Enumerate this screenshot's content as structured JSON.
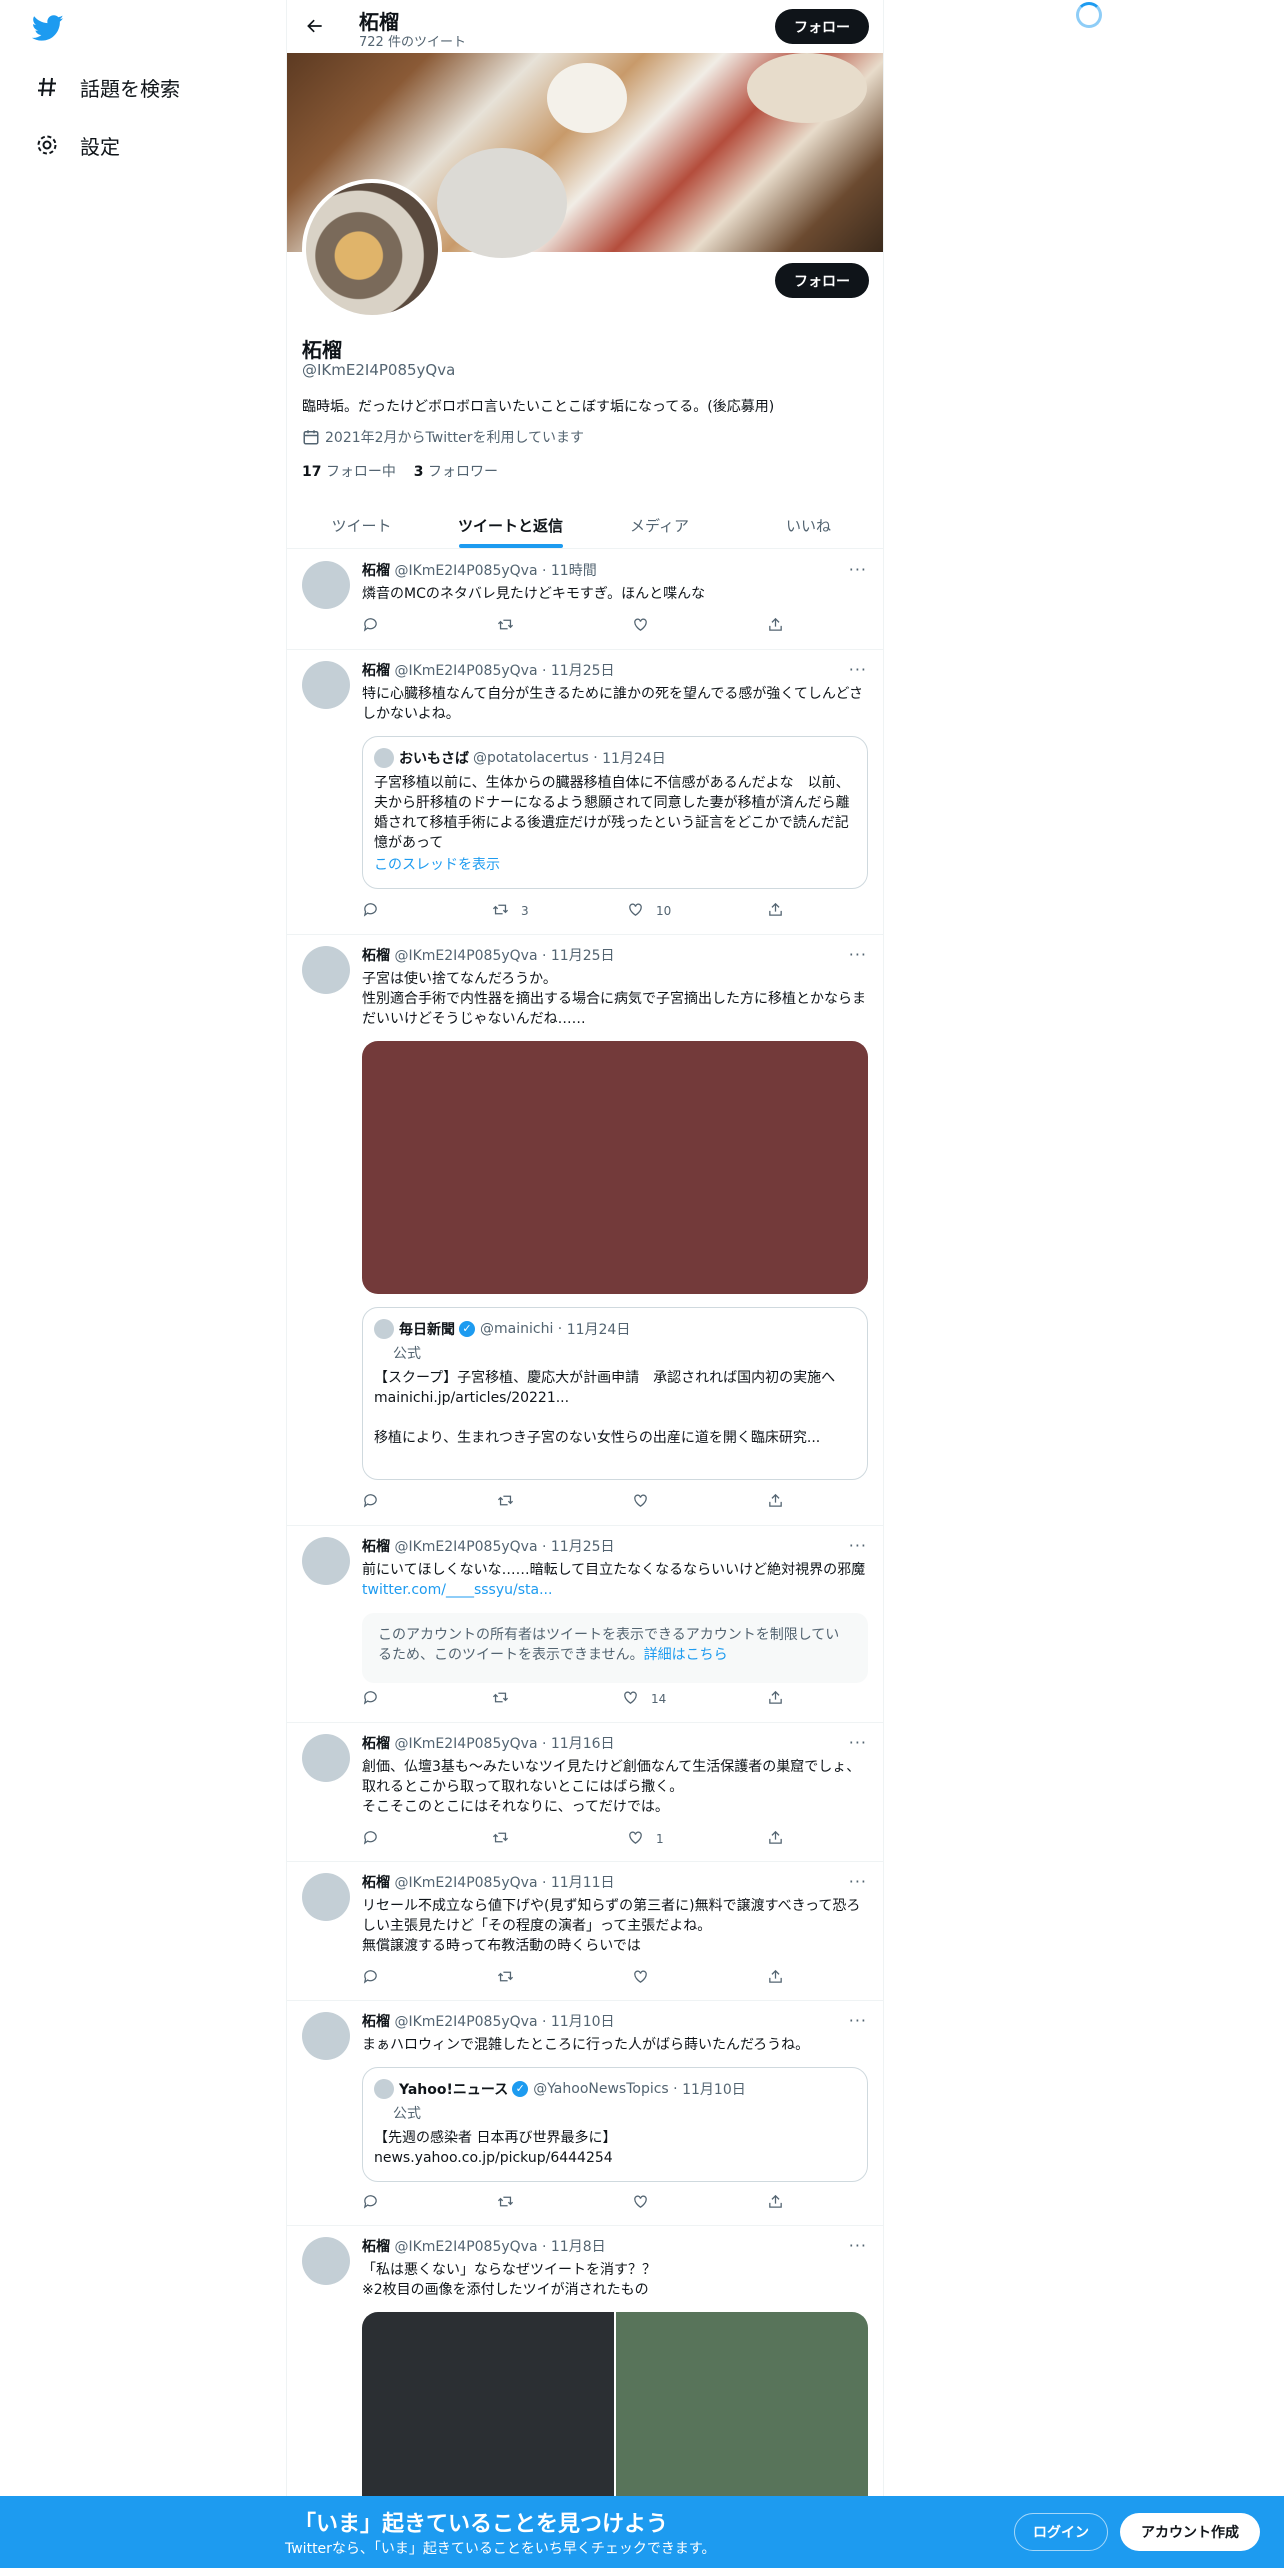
{
  "nav": {
    "items": [
      {
        "label": "話題を検索",
        "icon": "hashtag-icon"
      },
      {
        "label": "設定",
        "icon": "gear-icon"
      }
    ]
  },
  "header": {
    "name": "柘榴",
    "tweet_count": "722 件のツイート",
    "follow_label": "フォロー"
  },
  "profile": {
    "name": "柘榴",
    "handle": "@IKmE2I4P085yQva",
    "bio": "臨時垢。だったけどボロボロ言いたいことこぼす垢になってる。(後応募用)",
    "joined": "2021年2月からTwitterを利用しています",
    "following_count": "17",
    "following_label": "フォロー中",
    "followers_count": "3",
    "followers_label": "フォロワー",
    "follow_label": "フォロー"
  },
  "tabs": [
    {
      "label": "ツイート",
      "active": false
    },
    {
      "label": "ツイートと返信",
      "active": true
    },
    {
      "label": "メディア",
      "active": false
    },
    {
      "label": "いいね",
      "active": false
    }
  ],
  "tweets": [
    {
      "name": "柘榴",
      "handle": "@IKmE2I4P085yQva",
      "time": "11時間",
      "text": "燐音のMCのネタバレ見たけどキモすぎ。ほんと喋んな",
      "retweets": "",
      "likes": ""
    },
    {
      "name": "柘榴",
      "handle": "@IKmE2I4P085yQva",
      "time": "11月25日",
      "text": "特に心臓移植なんて自分が生きるために誰かの死を望んでる感が強くてしんどさしかないよね。",
      "quote": {
        "name": "おいもさば",
        "handle": "@potatolacertus",
        "time": "11月24日",
        "text": "子宮移植以前に、生体からの臓器移植自体に不信感があるんだよな　以前、夫から肝移植のドナーになるよう懇願されて同意した妻が移植が済んだら離婚されて移植手術による後遺症だけが残ったという証言をどこかで読んだ記憶があって",
        "thread": "このスレッドを表示"
      },
      "retweets": "3",
      "likes": "10"
    },
    {
      "name": "柘榴",
      "handle": "@IKmE2I4P085yQva",
      "time": "11月25日",
      "text": "子宮は使い捨てなんだろうか。\n性別適合手術で内性器を摘出する場合に病気で子宮摘出した方に移植とかならまだいいけどそうじゃないんだね……",
      "media_color": "#733a3a",
      "quote": {
        "name": "毎日新聞",
        "handle": "@mainichi",
        "time": "11月24日",
        "badge": "公式",
        "text": "【スクープ】子宮移植、慶応大が計画申請　承認されれば国内初の実施へ\nmainichi.jp/articles/20221...\n\n移植により、生まれつき子宮のない女性らの出産に道を開く臨床研究..."
      },
      "retweets": "",
      "likes": ""
    },
    {
      "name": "柘榴",
      "handle": "@IKmE2I4P085yQva",
      "time": "11月25日",
      "text": "前にいてほしくないな……暗転して目立たなくなるならいいけど絶対視界の邪魔",
      "link": "twitter.com/____sssyu/sta...",
      "notice": "このアカウントの所有者はツイートを表示できるアカウントを制限しているため、このツイートを表示できません。",
      "notice_link": "詳細はこちら",
      "retweets": "",
      "likes": "14"
    },
    {
      "name": "柘榴",
      "handle": "@IKmE2I4P085yQva",
      "time": "11月16日",
      "text": "創価、仏壇3基も～みたいなツイ見たけど創価なんて生活保護者の巣窟でしょ、取れるとこから取って取れないとこにはばら撒く。\nそこそこのとこにはそれなりに、ってだけでは。",
      "retweets": "",
      "likes": "1"
    },
    {
      "name": "柘榴",
      "handle": "@IKmE2I4P085yQva",
      "time": "11月11日",
      "text": "リセール不成立なら値下げや(見ず知らずの第三者に)無料で譲渡すべきって恐ろしい主張見たけど「その程度の演者」って主張だよね。\n無償譲渡する時って布教活動の時くらいでは",
      "retweets": "",
      "likes": ""
    },
    {
      "name": "柘榴",
      "handle": "@IKmE2I4P085yQva",
      "time": "11月10日",
      "text": "まぁハロウィンで混雑したところに行った人がばら蒔いたんだろうね。",
      "quote": {
        "name": "Yahoo!ニュース",
        "handle": "@YahooNewsTopics",
        "time": "11月10日",
        "badge": "公式",
        "text": "【先週の感染者 日本再び世界最多に】\nnews.yahoo.co.jp/pickup/6444254"
      },
      "retweets": "",
      "likes": ""
    },
    {
      "name": "柘榴",
      "handle": "@IKmE2I4P085yQva",
      "time": "11月8日",
      "text": "「私は悪くない」ならなぜツイートを消す？？\n※2枚目の画像を添付したツイが消されたもの",
      "media_colors": [
        "#2b2f33",
        "#58745a"
      ]
    }
  ],
  "bottom_bar": {
    "title": "「いま」起きていることを見つけよう",
    "subtitle": "Twitterなら、「いま」起きていることをいち早くチェックできます。",
    "login_label": "ログイン",
    "signup_label": "アカウント作成"
  },
  "colors": {
    "accent": "#1d9bf0",
    "text": "#0f1419",
    "muted": "#536471"
  }
}
